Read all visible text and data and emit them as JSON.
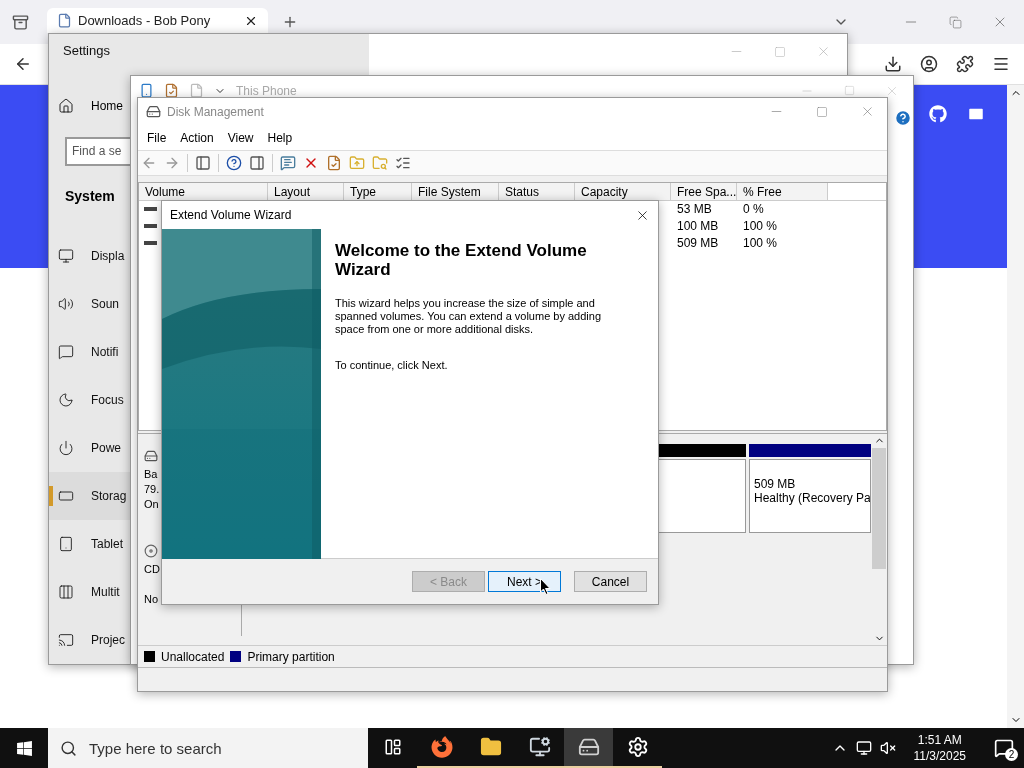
{
  "browser": {
    "tab": {
      "title": "Downloads - Bob Pony"
    }
  },
  "settings": {
    "title": "Settings",
    "home": "Home",
    "search": {
      "placeholder": "Find a se"
    },
    "section": "System",
    "nav": [
      {
        "label": "Displa",
        "selected": false
      },
      {
        "label": "Soun",
        "selected": false
      },
      {
        "label": "Notifi",
        "selected": false
      },
      {
        "label": "Focus",
        "selected": false
      },
      {
        "label": "Powe",
        "selected": false
      },
      {
        "label": "Storag",
        "selected": true
      },
      {
        "label": "Tablet",
        "selected": false
      },
      {
        "label": "Multit",
        "selected": false
      },
      {
        "label": "Projec",
        "selected": false
      }
    ]
  },
  "explorer": {
    "title": "This Phone"
  },
  "disk_management": {
    "title": "Disk Management",
    "menu": [
      "File",
      "Action",
      "View",
      "Help"
    ],
    "columns": [
      "Volume",
      "Layout",
      "Type",
      "File System",
      "Status",
      "Capacity",
      "Free Spa...",
      "% Free"
    ],
    "volumes": [
      {
        "free": "53 MB",
        "percent_free": "0 %"
      },
      {
        "free": "100 MB",
        "percent_free": "100 %"
      },
      {
        "free": "509 MB",
        "percent_free": "100 %"
      }
    ],
    "disks": [
      {
        "kind": "disk",
        "lines": [
          "Ba",
          "79.",
          "On"
        ],
        "partitions": [
          {
            "color": "#000000"
          },
          {
            "color": "#000080",
            "size": "509 MB",
            "status": "Healthy (Recovery Pa"
          }
        ]
      },
      {
        "kind": "cdrom",
        "lines": [
          "CD",
          "No"
        ]
      }
    ],
    "legend": [
      {
        "label": "Unallocated",
        "color": "#000000"
      },
      {
        "label": "Primary partition",
        "color": "#000080"
      }
    ]
  },
  "wizard": {
    "title": "Extend Volume Wizard",
    "heading": "Welcome to the Extend Volume Wizard",
    "body": "This wizard helps you increase the size of simple and spanned volumes. You can extend a volume  by adding space from one or more additional disks.",
    "hint": "To continue, click Next.",
    "buttons": [
      {
        "label": "< Back",
        "disabled": true,
        "focused": false
      },
      {
        "label": "Next >",
        "disabled": false,
        "focused": true
      },
      {
        "label": "Cancel",
        "disabled": false,
        "focused": false
      }
    ]
  },
  "taskbar": {
    "search": {
      "placeholder": "Type here to search"
    },
    "apps": [
      {
        "kind": "taskview",
        "selected": false
      },
      {
        "kind": "browser",
        "selected": false
      },
      {
        "kind": "folder",
        "selected": false
      },
      {
        "kind": "monitor",
        "selected": false
      },
      {
        "kind": "disk",
        "selected": true
      },
      {
        "kind": "settings",
        "selected": false
      }
    ],
    "time": "1:51 AM",
    "date": "11/3/2025",
    "notifications": "2"
  }
}
